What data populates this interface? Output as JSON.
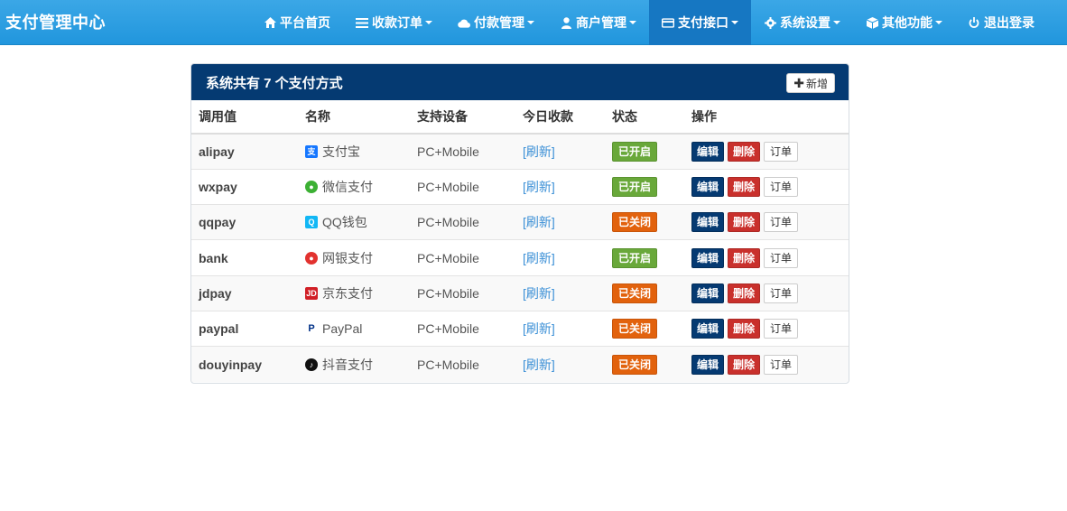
{
  "brand": "支付管理中心",
  "nav": [
    {
      "label": "平台首页",
      "icon": "home-icon",
      "caret": false,
      "active": false
    },
    {
      "label": "收款订单",
      "icon": "list-icon",
      "caret": true,
      "active": false
    },
    {
      "label": "付款管理",
      "icon": "cloud-icon",
      "caret": true,
      "active": false
    },
    {
      "label": "商户管理",
      "icon": "user-icon",
      "caret": true,
      "active": false
    },
    {
      "label": "支付接口",
      "icon": "credit-card-icon",
      "caret": true,
      "active": true
    },
    {
      "label": "系统设置",
      "icon": "gear-icon",
      "caret": true,
      "active": false
    },
    {
      "label": "其他功能",
      "icon": "cube-icon",
      "caret": true,
      "active": false
    },
    {
      "label": "退出登录",
      "icon": "power-icon",
      "caret": false,
      "active": false
    }
  ],
  "panel": {
    "title": "系统共有 7 个支付方式",
    "add_label": "新增"
  },
  "table": {
    "headers": [
      "调用值",
      "名称",
      "支持设备",
      "今日收款",
      "状态",
      "操作"
    ],
    "rows": [
      {
        "code": "alipay",
        "name": "支付宝",
        "icon": "alipay-icon",
        "icon_color": "#1677ff",
        "icon_glyph": "支",
        "device": "PC+Mobile",
        "today": "[刷新]",
        "status": "已开启",
        "on": true
      },
      {
        "code": "wxpay",
        "name": "微信支付",
        "icon": "wechat-pay-icon",
        "icon_color": "#3cb034",
        "icon_glyph": "●",
        "device": "PC+Mobile",
        "today": "[刷新]",
        "status": "已开启",
        "on": true
      },
      {
        "code": "qqpay",
        "name": "QQ钱包",
        "icon": "qq-wallet-icon",
        "icon_color": "#12b7f5",
        "icon_glyph": "Q",
        "device": "PC+Mobile",
        "today": "[刷新]",
        "status": "已关闭",
        "on": false
      },
      {
        "code": "bank",
        "name": "网银支付",
        "icon": "unionpay-icon",
        "icon_color": "#e2322f",
        "icon_glyph": "●",
        "device": "PC+Mobile",
        "today": "[刷新]",
        "status": "已开启",
        "on": true
      },
      {
        "code": "jdpay",
        "name": "京东支付",
        "icon": "jd-icon",
        "icon_color": "#d11f26",
        "icon_glyph": "JD",
        "device": "PC+Mobile",
        "today": "[刷新]",
        "status": "已关闭",
        "on": false
      },
      {
        "code": "paypal",
        "name": "PayPal",
        "icon": "paypal-icon",
        "icon_color": "#ffffff",
        "icon_glyph": "P",
        "device": "PC+Mobile",
        "today": "[刷新]",
        "status": "已关闭",
        "on": false
      },
      {
        "code": "douyinpay",
        "name": "抖音支付",
        "icon": "douyin-icon",
        "icon_color": "#111111",
        "icon_glyph": "♪",
        "device": "PC+Mobile",
        "today": "[刷新]",
        "status": "已关闭",
        "on": false
      }
    ],
    "op_labels": {
      "edit": "编辑",
      "delete": "删除",
      "orders": "订单"
    }
  },
  "colors": {
    "navbar": "#2196dd",
    "nav_active": "#1677c2",
    "panel_heading": "#053a72",
    "status_on": "#69a83a",
    "status_off": "#e2620d",
    "delete": "#c9302c"
  }
}
